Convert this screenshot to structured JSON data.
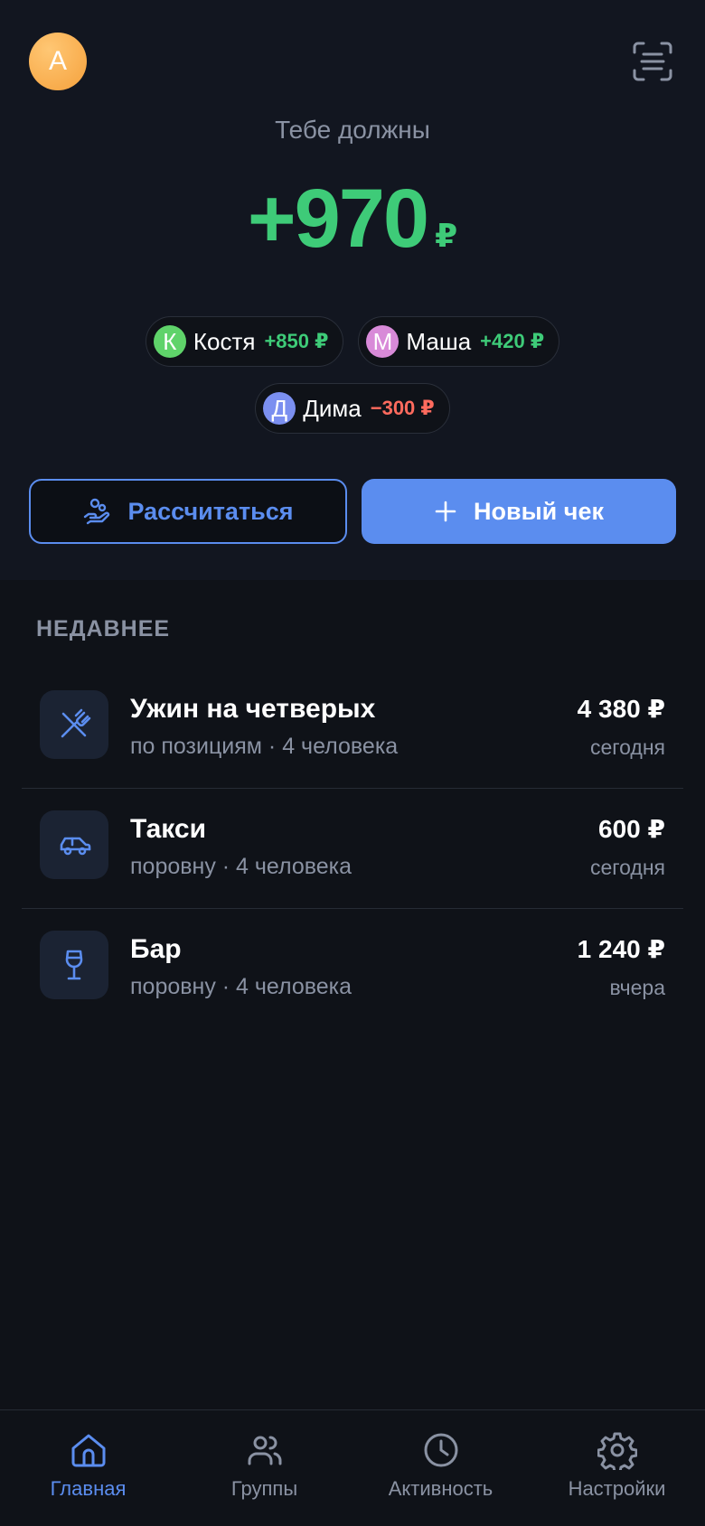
{
  "header": {
    "avatar_letter": "А",
    "scan_icon": "scan-receipt-icon"
  },
  "summary": {
    "label": "Тебе должны",
    "amount": "+970",
    "currency": "₽",
    "accent": "#3ecb78"
  },
  "debtors": [
    {
      "initial": "К",
      "name": "Костя",
      "amount": "+850 ₽",
      "color": "#5fd36a",
      "status": "positive"
    },
    {
      "initial": "М",
      "name": "Маша",
      "amount": "+420 ₽",
      "color": "#d88ad8",
      "status": "positive"
    },
    {
      "initial": "Д",
      "name": "Дима",
      "amount": "−300 ₽",
      "color": "#7b8ff0",
      "status": "negative"
    }
  ],
  "actions": {
    "settle_label": "Рассчитаться",
    "new_check_label": "Новый чек"
  },
  "recent": {
    "title": "НЕДАВНЕЕ",
    "items": [
      {
        "title": "Ужин на четверых",
        "subtitle": "по позициям · 4 человека",
        "amount": "4 380 ₽",
        "date": "сегодня",
        "icon": "fork-knife-icon"
      },
      {
        "title": "Такси",
        "subtitle": "поровну · 4 человека",
        "amount": "600 ₽",
        "date": "сегодня",
        "icon": "car-icon"
      },
      {
        "title": "Бар",
        "subtitle": "поровну · 4 человека",
        "amount": "1 240 ₽",
        "date": "вчера",
        "icon": "wine-glass-icon"
      }
    ]
  },
  "tabs": [
    {
      "label": "Главная",
      "icon": "home-icon",
      "active": true
    },
    {
      "label": "Группы",
      "icon": "users-icon",
      "active": false
    },
    {
      "label": "Активность",
      "icon": "clock-icon",
      "active": false
    },
    {
      "label": "Настройки",
      "icon": "gear-icon",
      "active": false
    }
  ],
  "colors": {
    "positive": "#3ecb78",
    "negative": "#ff6b5e",
    "accent": "#5b8def"
  }
}
